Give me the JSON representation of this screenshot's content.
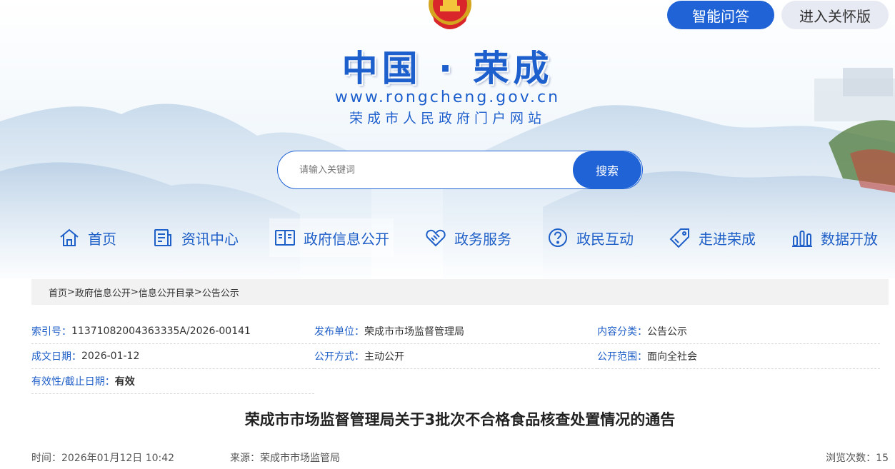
{
  "header": {
    "title": "中国 · 荣成",
    "url": "www.rongcheng.gov.cn",
    "subtitle": "荣成市人民政府门户网站",
    "ai_button": "智能问答",
    "care_button": "进入关怀版"
  },
  "search": {
    "placeholder": "请输入关键词",
    "button": "搜索"
  },
  "nav": {
    "items": [
      {
        "label": "首页",
        "icon": "home-icon"
      },
      {
        "label": "资讯中心",
        "icon": "news-icon"
      },
      {
        "label": "政府信息公开",
        "icon": "book-icon"
      },
      {
        "label": "政务服务",
        "icon": "handshake-icon"
      },
      {
        "label": "政民互动",
        "icon": "question-icon"
      },
      {
        "label": "走进荣成",
        "icon": "tag-icon"
      },
      {
        "label": "数据开放",
        "icon": "bar-chart-icon"
      }
    ],
    "active_index": 2
  },
  "breadcrumb": {
    "items": [
      "首页",
      "政府信息公开",
      "信息公开目录",
      "公告公示"
    ],
    "separator": ">"
  },
  "meta": {
    "index_no_label": "索引号：",
    "index_no": "11371082004363335A/2026-00141",
    "publisher_label": "发布单位：",
    "publisher": "荣成市市场监督管理局",
    "category_label": "内容分类：",
    "category": "公告公示",
    "date_label": "成文日期：",
    "date": "2026-01-12",
    "method_label": "公开方式：",
    "method": "主动公开",
    "scope_label": "公开范围：",
    "scope": "面向全社会",
    "validity_label": "有效性/截止日期：",
    "validity": "有效"
  },
  "article": {
    "title": "荣成市市场监督管理局关于3批次不合格食品核查处置情况的通告",
    "time": "时间：2026年01月12日 10:42",
    "source": "来源：荣成市市场监管局",
    "views": "浏览次数：15"
  },
  "colors": {
    "primary": "#1f63d6",
    "link_blue": "#1f5fc8",
    "care_bg": "#e8eaf3"
  }
}
